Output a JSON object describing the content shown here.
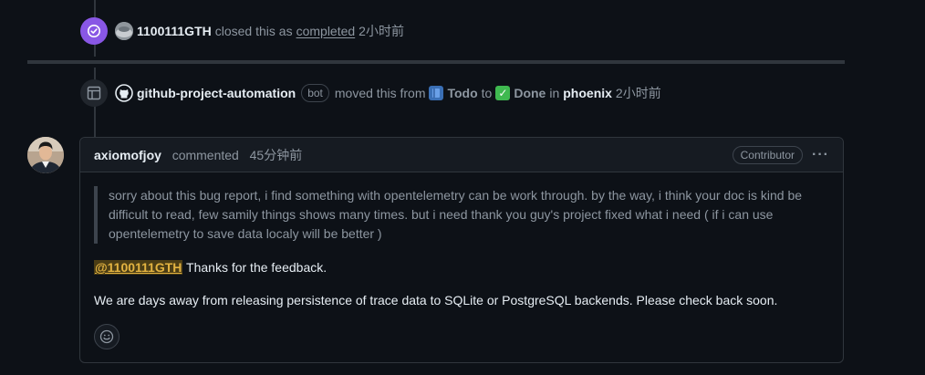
{
  "events": {
    "closed": {
      "actor": "1100111GTH",
      "action": "closed this as",
      "state": "completed",
      "time": "2小时前"
    },
    "moved": {
      "actor": "github-project-automation",
      "bot_label": "bot",
      "action": "moved this from",
      "from_column": "Todo",
      "to_word": "to",
      "to_column": "Done",
      "in_word": "in",
      "project": "phoenix",
      "time": "2小时前"
    }
  },
  "comment": {
    "author": "axiomofjoy",
    "action": "commented",
    "time": "45分钟前",
    "role": "Contributor",
    "quote": "sorry about this bug report, i find something with opentelemetry can be work through. by the way, i think your doc is kind be difficult to read, few samily things shows many times. but i need thank you guy's project fixed what i need ( if i can use opentelemetry to save data localy will be better )",
    "mention": "@1100111GTH",
    "reply": "Thanks for the feedback.",
    "paragraph2": "We are days away from releasing persistence of trace data to SQLite or PostgreSQL backends. Please check back soon."
  },
  "icons": {
    "closed_badge": "check-circle-icon",
    "project_badge": "table-icon",
    "bot_avatar": "github-mark-icon",
    "todo_emoji": "blue-book-icon",
    "done_emoji": "white-check-mark-icon",
    "more": "kebab-horizontal-icon",
    "reaction": "smiley-icon"
  },
  "colors": {
    "background": "#0d1117",
    "closed_purple": "#8957e5",
    "mention_bg": "#4b3d15",
    "mention_fg": "#e3b341"
  }
}
